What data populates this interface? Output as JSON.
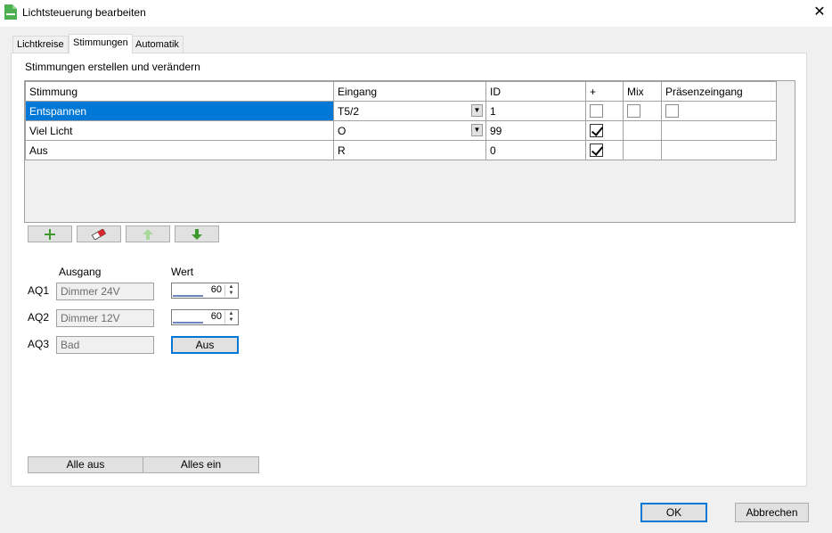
{
  "window": {
    "title": "Lichtsteuerung bearbeiten",
    "close_glyph": "✕"
  },
  "tabs": [
    {
      "label": "Lichtkreise",
      "active": false
    },
    {
      "label": "Stimmungen",
      "active": true
    },
    {
      "label": "Automatik",
      "active": false
    }
  ],
  "section": {
    "title": "Stimmungen erstellen und verändern"
  },
  "grid": {
    "columns": [
      "Stimmung",
      "Eingang",
      "ID",
      "+",
      "Mix",
      "Präsenzeingang"
    ],
    "rows": [
      {
        "name": "Entspannen",
        "input": "T5/2",
        "id": "1",
        "plus": false,
        "mix": false,
        "presence": false,
        "selected": true,
        "combo": true
      },
      {
        "name": "Viel Licht",
        "input": "O",
        "id": "99",
        "plus": true,
        "mix": null,
        "presence": null,
        "selected": false,
        "combo": true
      },
      {
        "name": "Aus",
        "input": "R",
        "id": "0",
        "plus": true,
        "mix": null,
        "presence": null,
        "selected": false,
        "combo": false
      }
    ]
  },
  "toolbar": {
    "add_icon": "plus-icon",
    "delete_icon": "eraser-icon",
    "up_icon": "arrow-up-icon",
    "down_icon": "arrow-down-icon"
  },
  "outputs": {
    "col_output": "Ausgang",
    "col_value": "Wert",
    "items": [
      {
        "label": "AQ1",
        "name": "Dimmer 24V",
        "value": "60",
        "level": 0.6
      },
      {
        "label": "AQ2",
        "name": "Dimmer 12V",
        "value": "60",
        "level": 0.6
      },
      {
        "label": "AQ3",
        "name": "Bad",
        "button": "Aus"
      }
    ]
  },
  "actions": {
    "all_off": "Alle aus",
    "all_on": "Alles ein"
  },
  "dialog": {
    "ok": "OK",
    "cancel": "Abbrechen"
  },
  "colors": {
    "selection": "#0078d7",
    "accent_green": "#4caf50"
  }
}
